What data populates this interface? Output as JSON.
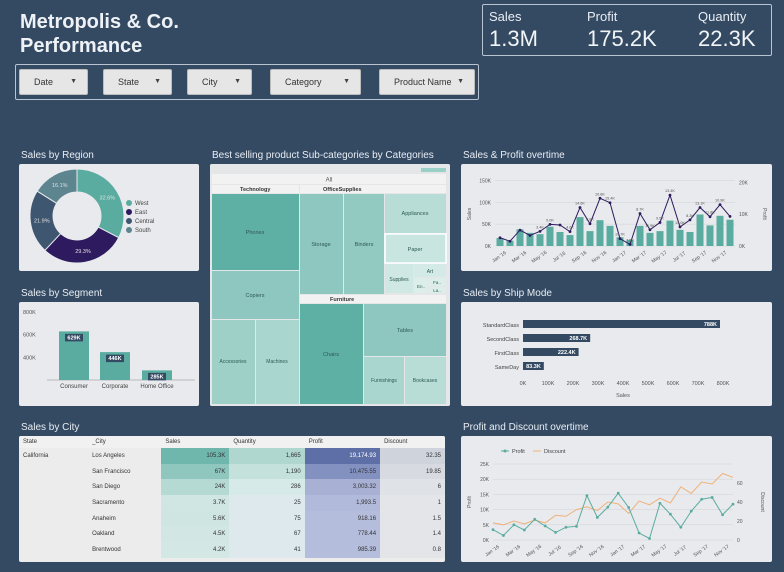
{
  "header": {
    "title": "Metropolis & Co. Performance"
  },
  "kpis": [
    {
      "label": "Sales",
      "value": "1.3M"
    },
    {
      "label": "Profit",
      "value": "175.2K"
    },
    {
      "label": "Quantity",
      "value": "22.3K"
    }
  ],
  "filters": [
    {
      "label": "Date"
    },
    {
      "label": "State"
    },
    {
      "label": "City"
    },
    {
      "label": "Category"
    },
    {
      "label": "Product Name"
    }
  ],
  "sections": {
    "region": "Sales by Region",
    "treemap": "Best selling product Sub-categories by Categories",
    "overtime": "Sales & Profit overtime",
    "segment": "Sales by Segment",
    "shipmode": "Sales by Ship Mode",
    "city": "Sales by City",
    "discount": "Profit and Discount overtime"
  },
  "colors": {
    "background": "#344a63",
    "teal": "#5aaca0",
    "purple": "#2e1a5e",
    "navy": "#344a63"
  },
  "region_chart": {
    "chart_data": {
      "type": "pie",
      "labels": [
        "West",
        "East",
        "Central",
        "South"
      ],
      "values": [
        32.6,
        29.3,
        21.9,
        16.1
      ],
      "value_labels": [
        "32.6%",
        "29.3%",
        "21.9%",
        "16.1%"
      ],
      "colors": [
        "#5aaca0",
        "#2e1a5e",
        "#3e5670",
        "#5d8590"
      ]
    }
  },
  "segment_chart": {
    "chart_data": {
      "type": "bar",
      "categories": [
        "Consumer",
        "Corporate",
        "Home Office"
      ],
      "values": [
        629,
        446,
        285
      ],
      "value_labels": [
        "629K",
        "446K",
        "285K"
      ],
      "yticks": [
        "400K",
        "600K",
        "800K"
      ],
      "ylim": [
        200,
        800
      ]
    }
  },
  "ship_chart": {
    "chart_data": {
      "type": "bar",
      "categories": [
        "StandardClass",
        "SecondClass",
        "FirstClass",
        "SameDay"
      ],
      "values": [
        788,
        268.7,
        222.4,
        83.3
      ],
      "value_labels": [
        "788K",
        "268.7K",
        "222.4K",
        "83.3K"
      ],
      "xticks": [
        "0K",
        "100K",
        "200K",
        "300K",
        "400K",
        "500K",
        "600K",
        "700K",
        "800K"
      ],
      "xlabel": "Sales",
      "xlim": [
        0,
        800
      ]
    }
  },
  "treemap": {
    "title": "All",
    "categories": [
      "Technology",
      "OfficeSupplies",
      "Furniture"
    ],
    "tiles": [
      "Phones",
      "Copiers",
      "Accessories",
      "Machines",
      "Storage",
      "Binders",
      "Appliances",
      "Paper",
      "Supplies",
      "Art",
      "En..",
      "Fa..",
      "La..",
      "Chairs",
      "Tables",
      "Furnishings",
      "Bookcases"
    ]
  },
  "overtime_chart": {
    "chart_data": {
      "type": "bar",
      "x_ticks": [
        "Jan '16",
        "Mar '16",
        "May '16",
        "Jul '16",
        "Sep '16",
        "Nov '16",
        "Jan '17",
        "Mar '17",
        "May '17",
        "Jul '17",
        "Sep '17",
        "Nov '17"
      ],
      "y_left_ticks": [
        "0K",
        "50K",
        "100K",
        "150K"
      ],
      "y_right_ticks": [
        "0K",
        "10K",
        "20K"
      ],
      "ylabel_left": "Sales",
      "ylabel_right": "Profit",
      "series": [
        {
          "name": "Sales",
          "values": [
            18,
            12,
            38,
            30,
            27,
            44,
            32,
            25,
            66,
            34,
            59,
            46,
            20,
            14,
            46,
            30,
            34,
            58,
            37,
            32,
            72,
            47,
            69,
            60
          ]
        },
        {
          "name": "Profit",
          "values": [
            2.6,
            1.5,
            5.0,
            3.3,
            4.6,
            6.8,
            6.6,
            4.5,
            12.1,
            7.0,
            15.0,
            13.6,
            2.3,
            0.5,
            10.2,
            5.1,
            7.4,
            16.0,
            6.0,
            8.2,
            12.1,
            9.2,
            13.0,
            9.3
          ]
        }
      ],
      "point_labels": [
        "3.4K",
        "5.0K",
        "4.6K",
        "6.8K",
        "14.6K",
        "10.8K",
        "15.4K",
        "10.7K",
        "7.5K",
        "8.7K",
        "11.9K",
        "9.5K",
        "13.4K",
        "14.0K",
        "8.3K",
        "13.1K",
        "11.8K",
        "10.9K"
      ]
    }
  },
  "city_table": {
    "headers": [
      "State",
      "_City",
      "Sales",
      "Quantity",
      "Profit",
      "Discount"
    ],
    "state": "California",
    "rows": [
      {
        "city": "Los Angeles",
        "sales": "105.3K",
        "quantity": "1,665",
        "profit": "19,174.93",
        "discount": "32.35"
      },
      {
        "city": "San Francisco",
        "sales": "67K",
        "quantity": "1,190",
        "profit": "10,475.55",
        "discount": "19.85"
      },
      {
        "city": "San Diego",
        "sales": "24K",
        "quantity": "286",
        "profit": "3,003.32",
        "discount": "6"
      },
      {
        "city": "Sacramento",
        "sales": "3.7K",
        "quantity": "25",
        "profit": "1,993.5",
        "discount": "1"
      },
      {
        "city": "Anaheim",
        "sales": "5.6K",
        "quantity": "75",
        "profit": "918.16",
        "discount": "1.5"
      },
      {
        "city": "Oakland",
        "sales": "4.5K",
        "quantity": "67",
        "profit": "778.44",
        "discount": "1.4"
      },
      {
        "city": "Brentwood",
        "sales": "4.2K",
        "quantity": "41",
        "profit": "985.39",
        "discount": "0.8"
      }
    ]
  },
  "discount_chart": {
    "chart_data": {
      "type": "line",
      "legend": [
        "Profit",
        "Discount"
      ],
      "x_ticks": [
        "Jan '16",
        "Mar '16",
        "May '16",
        "Jul '16",
        "Sep '16",
        "Nov '16",
        "Jan '17",
        "Mar '17",
        "May '17",
        "Jul '17",
        "Sep '17",
        "Nov '17"
      ],
      "y_left_ticks": [
        "0K",
        "5K",
        "10K",
        "15K",
        "20K",
        "25K"
      ],
      "y_right_ticks": [
        "0",
        "20",
        "40",
        "60"
      ],
      "ylabel_left": "Profit",
      "ylabel_right": "Discount",
      "series": [
        {
          "name": "Profit",
          "values": [
            3.4,
            1.5,
            5.0,
            3.3,
            6.8,
            4.6,
            2.5,
            4.2,
            4.5,
            14.6,
            7.4,
            10.8,
            15.4,
            10.7,
            2.3,
            0.5,
            12.1,
            8.5,
            4.2,
            9.5,
            13.4,
            14.0,
            8.3,
            11.8
          ]
        },
        {
          "name": "Discount",
          "values": [
            18,
            16,
            20,
            17,
            21,
            18,
            26,
            25,
            32,
            35,
            31,
            40,
            38,
            28,
            41,
            37,
            44,
            39,
            56,
            49,
            61,
            59,
            70,
            66
          ]
        }
      ]
    }
  }
}
